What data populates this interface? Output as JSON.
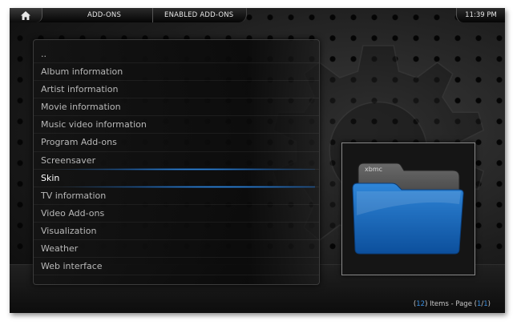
{
  "header": {
    "home_icon": "home-icon",
    "breadcrumbs": [
      "ADD-ONS",
      "ENABLED ADD-ONS"
    ],
    "clock": "11:39 PM"
  },
  "list": {
    "items": [
      "..",
      "Album information",
      "Artist information",
      "Movie information",
      "Music video information",
      "Program Add-ons",
      "Screensaver",
      "Skin",
      "TV information",
      "Video Add-ons",
      "Visualization",
      "Weather",
      "Web interface"
    ],
    "focused_label": "Skin"
  },
  "thumbnail": {
    "folder_label": "xbmc",
    "icon": "folder-icon"
  },
  "footer": {
    "count": "12",
    "items_text": " Items - Page ",
    "page_current": "1",
    "page_total": "1"
  },
  "colors": {
    "accent": "#3a8fe0",
    "background": "#1a1a1a",
    "text": "#b8b8b8"
  }
}
